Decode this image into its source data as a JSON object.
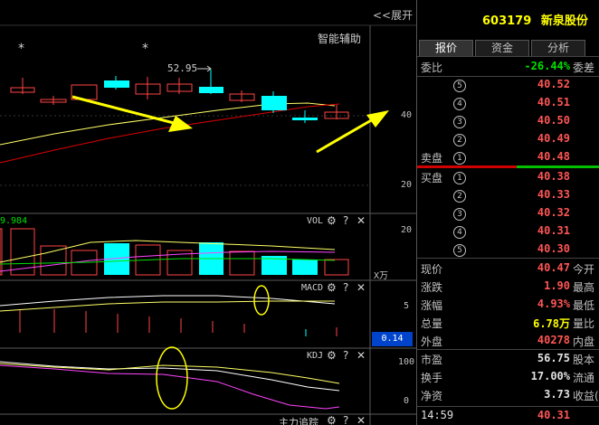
{
  "toolbar": {
    "expand_label": "<<展开"
  },
  "chart": {
    "assist_label": "智能辅助",
    "price_marker": "52.95",
    "ma_value": "9.984",
    "price_axis": [
      "40",
      "20"
    ],
    "vol": {
      "title": "VOL",
      "axis": [
        "20"
      ],
      "unit": "X万"
    },
    "macd": {
      "title": "MACD",
      "axis": "5",
      "value": "0.14"
    },
    "kdj": {
      "title": "KDJ",
      "axis": [
        "100",
        "0"
      ]
    },
    "bottom_title": "主力追踪",
    "gear_icon": "⚙",
    "help_icon": "?",
    "close_icon": "✕",
    "colors": {
      "up": "#ff4444",
      "down": "#00ffff",
      "arrow": "#ffff00",
      "ma1": "#ffff66",
      "ma2": "#dd0000"
    }
  },
  "stock": {
    "code": "603179",
    "name": "新泉股份"
  },
  "tabs": [
    {
      "label": "报价"
    },
    {
      "label": "资金"
    },
    {
      "label": "分析"
    }
  ],
  "commission": {
    "label": "委比",
    "value": "-26.44%",
    "right": "委差"
  },
  "asks": [
    {
      "num": "5",
      "price": "40.52"
    },
    {
      "num": "4",
      "price": "40.51"
    },
    {
      "num": "3",
      "price": "40.50"
    },
    {
      "num": "2",
      "price": "40.49"
    },
    {
      "num": "1",
      "price": "40.48",
      "label": "卖盘"
    }
  ],
  "bids": [
    {
      "num": "1",
      "price": "40.38",
      "label": "买盘"
    },
    {
      "num": "2",
      "price": "40.33"
    },
    {
      "num": "3",
      "price": "40.32"
    },
    {
      "num": "4",
      "price": "40.31"
    },
    {
      "num": "5",
      "price": "40.30"
    }
  ],
  "stats": [
    {
      "label": "现价",
      "value": "40.47",
      "right": "今开"
    },
    {
      "label": "涨跌",
      "value": "1.90",
      "right": "最高"
    },
    {
      "label": "涨幅",
      "value": "4.93%",
      "right": "最低"
    },
    {
      "label": "总量",
      "value": "6.78万",
      "right": "量比"
    },
    {
      "label": "外盘",
      "value": "40278",
      "right": "内盘"
    },
    {
      "label": "市盈",
      "value": "56.75",
      "right": "股本"
    },
    {
      "label": "换手",
      "value": "17.00%",
      "right": "流通"
    },
    {
      "label": "净资",
      "value": "3.73",
      "right": "收益(四)"
    }
  ],
  "tick": {
    "time": "14:59",
    "price": "40.31"
  },
  "chart_data": {
    "type": "candlestick",
    "candles": [
      {
        "o": 0,
        "c": 0,
        "dir": "up"
      },
      {
        "o": 0,
        "c": 0,
        "dir": "up"
      },
      {
        "o": 0,
        "c": 0,
        "dir": "up"
      }
    ]
  }
}
